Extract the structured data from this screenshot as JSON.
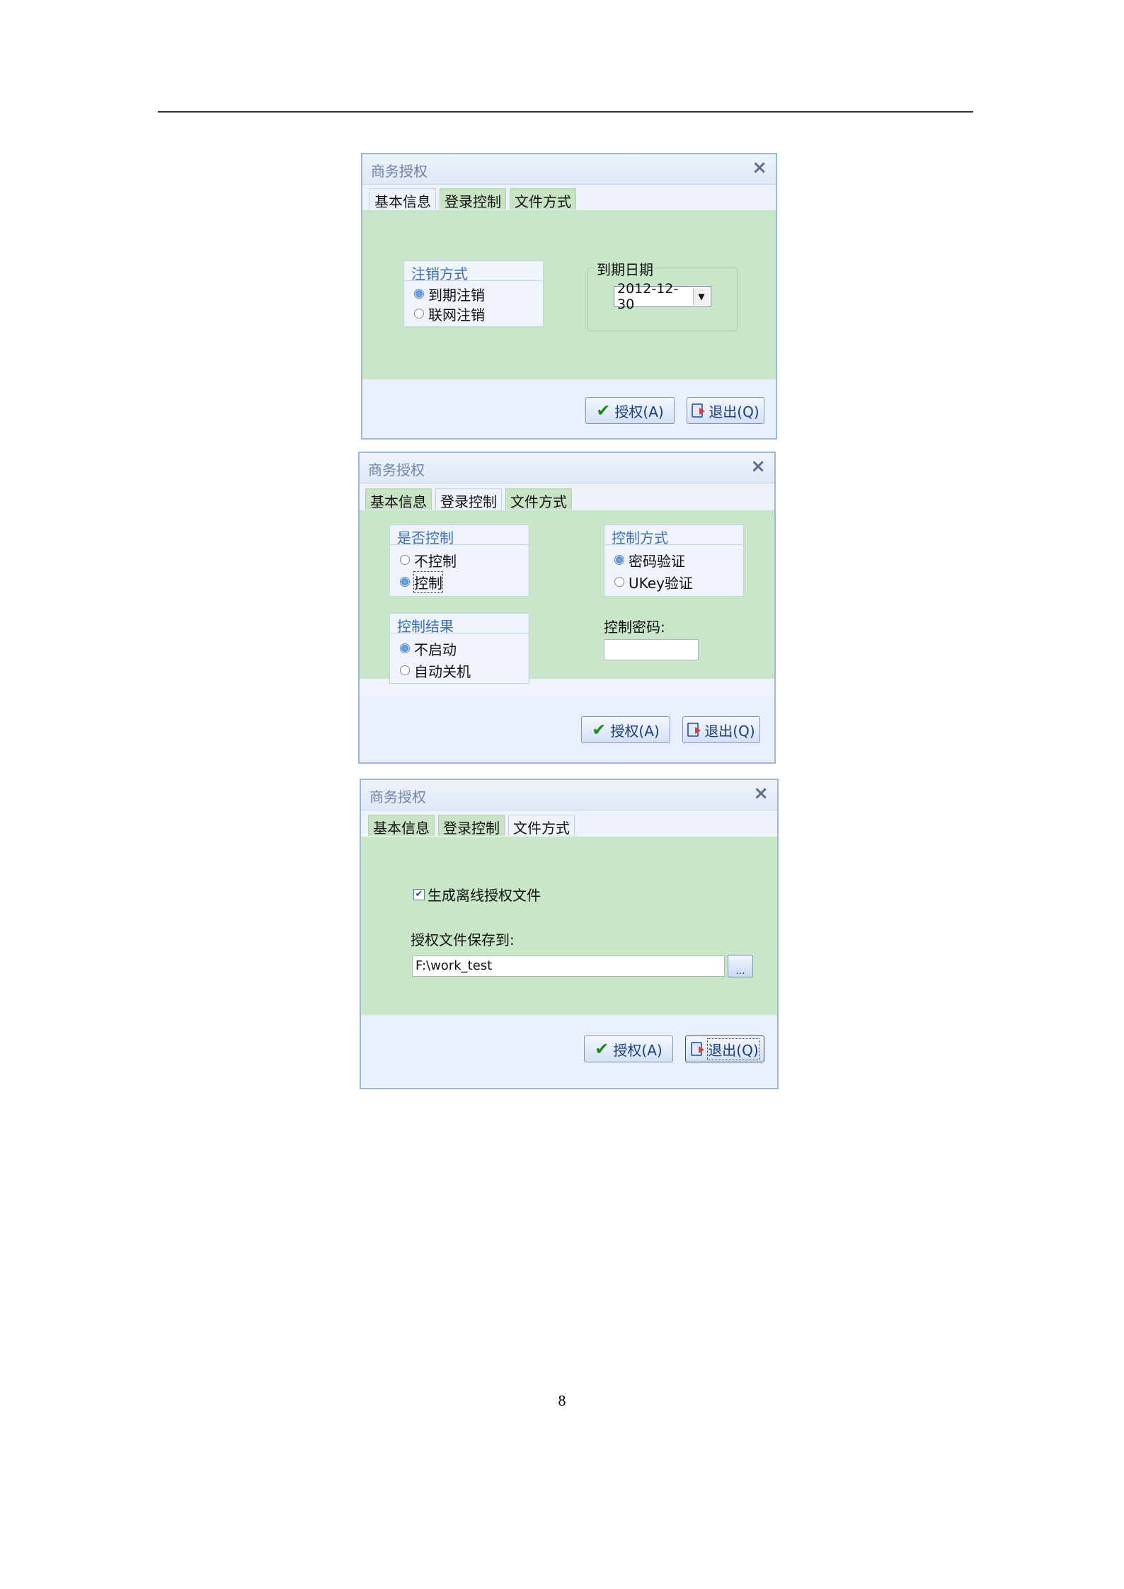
{
  "page": {
    "number": "8"
  },
  "common": {
    "title": "商务授权",
    "close_glyph": "×",
    "tabs": [
      "基本信息",
      "登录控制",
      "文件方式"
    ],
    "authorize_label": "授权(A)",
    "exit_label": "退出(Q)"
  },
  "dialog1": {
    "active_tab": "基本信息",
    "cancel_group": {
      "title": "注销方式",
      "options": [
        {
          "label": "到期注销",
          "selected": true
        },
        {
          "label": "联网注销",
          "selected": false
        }
      ]
    },
    "expiry": {
      "label": "到期日期",
      "value": "2012-12-30"
    }
  },
  "dialog2": {
    "active_tab": "登录控制",
    "control_group": {
      "title": "是否控制",
      "options": [
        {
          "label": "不控制",
          "selected": false
        },
        {
          "label": "控制",
          "selected": true
        }
      ]
    },
    "method_group": {
      "title": "控制方式",
      "options": [
        {
          "label": "密码验证",
          "selected": true
        },
        {
          "label": "UKey验证",
          "selected": false
        }
      ]
    },
    "result_group": {
      "title": "控制结果",
      "options": [
        {
          "label": "不启动",
          "selected": true
        },
        {
          "label": "自动关机",
          "selected": false
        }
      ]
    },
    "password": {
      "label": "控制密码:",
      "value": ""
    }
  },
  "dialog3": {
    "active_tab": "文件方式",
    "generate_offline": {
      "label": "生成离线授权文件",
      "checked": true
    },
    "save_to": {
      "label": "授权文件保存到:",
      "value": "F:\\work_test"
    },
    "browse_label": "..."
  }
}
